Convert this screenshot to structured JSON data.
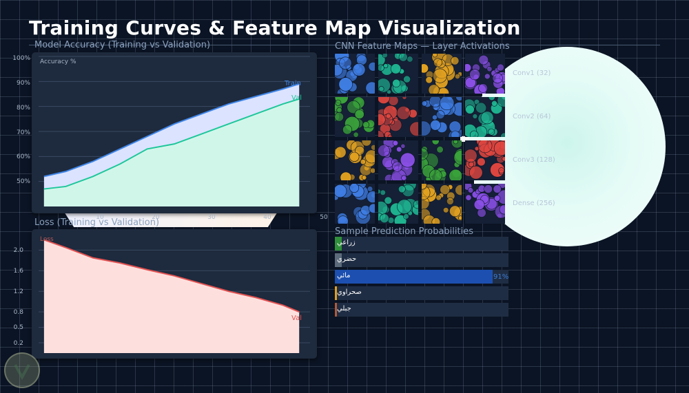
{
  "page": {
    "title": "Training Curves & Feature Map Visualization"
  },
  "accuracy": {
    "title": "Model Accuracy (Training vs Validation)",
    "inner_label": "Accuracy %",
    "y_ticks": [
      "100%",
      "90%",
      "80%",
      "70%",
      "60%",
      "50%"
    ],
    "x_ticks": [
      "10",
      "20",
      "30",
      "40",
      "50"
    ]
  },
  "loss": {
    "title": "Loss (Training vs Validation)",
    "inner_label": "Loss",
    "y_ticks": [
      "2.0",
      "1.6",
      "1.2",
      "0.8",
      "0.5",
      "0.2"
    ]
  },
  "feature_maps": {
    "title": "CNN Feature Maps — Layer Activations",
    "layers": [
      "Conv1 (32)",
      "Conv2 (64)",
      "Conv3 (128)",
      "Dense (256)"
    ],
    "palette": [
      "#3f7de3",
      "#1fb592",
      "#e0a020",
      "#8a4fe6",
      "#3aa23a",
      "#e0463f"
    ]
  },
  "predictions": {
    "title": "Sample Prediction Probabilities",
    "items": [
      {
        "label": "زراعي",
        "pct": 0.04,
        "color": "#2f8f3a",
        "pct_text": ""
      },
      {
        "label": "حضري",
        "pct": 0.04,
        "color": "#5c6b7c",
        "pct_text": ""
      },
      {
        "label": "مائي",
        "pct": 0.91,
        "color": "#1c4fb0",
        "pct_text": "91%"
      },
      {
        "label": "صحراوي",
        "pct": 0.01,
        "color": "#e0a020",
        "pct_text": ""
      },
      {
        "label": "جبلي",
        "pct": 0.01,
        "color": "#b05a3a",
        "pct_text": ""
      }
    ]
  },
  "chart_data": [
    {
      "type": "area",
      "title": "Model Accuracy (Training vs Validation)",
      "ylabel": "Accuracy %",
      "xlim": [
        0,
        50
      ],
      "ylim": [
        40,
        100
      ],
      "x": [
        1,
        5,
        10,
        15,
        20,
        25,
        30,
        35,
        40,
        45,
        48
      ],
      "series": [
        {
          "name": "Train",
          "color": "#3f85e6",
          "values": [
            52,
            54,
            58,
            63,
            68,
            73,
            77,
            81,
            84,
            87,
            89
          ]
        },
        {
          "name": "Val",
          "color": "#1fc79a",
          "values": [
            47,
            48,
            52,
            57,
            63,
            65,
            69,
            73,
            77,
            81,
            83
          ]
        }
      ],
      "grid": true
    },
    {
      "type": "area",
      "title": "Loss (Training vs Validation)",
      "ylabel": "Loss",
      "xlim": [
        0,
        50
      ],
      "ylim": [
        0,
        2.3
      ],
      "x": [
        1,
        5,
        10,
        15,
        20,
        25,
        30,
        35,
        40,
        45,
        48
      ],
      "series": [
        {
          "name": "Val",
          "color": "#e05252",
          "values": [
            2.2,
            2.05,
            1.85,
            1.75,
            1.62,
            1.5,
            1.35,
            1.2,
            1.08,
            0.93,
            0.8
          ]
        }
      ],
      "grid": true
    }
  ]
}
